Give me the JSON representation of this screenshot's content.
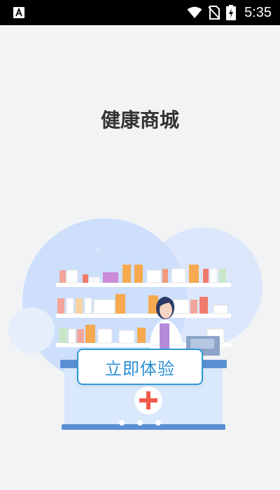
{
  "status_bar": {
    "time": "5:35",
    "icons": [
      "accessibility-icon",
      "wifi-icon",
      "no-sim-icon",
      "battery-charging-icon"
    ]
  },
  "page": {
    "title": "健康商城"
  },
  "cta": {
    "label": "立即体验"
  },
  "pager": {
    "count": 3,
    "active_index": 0
  },
  "colors": {
    "background": "#f2f3f5",
    "accent": "#2f9ad6",
    "circle_light": "#cfe0fb",
    "counter": "#d9e8fb",
    "cross": "#f05a4a"
  }
}
